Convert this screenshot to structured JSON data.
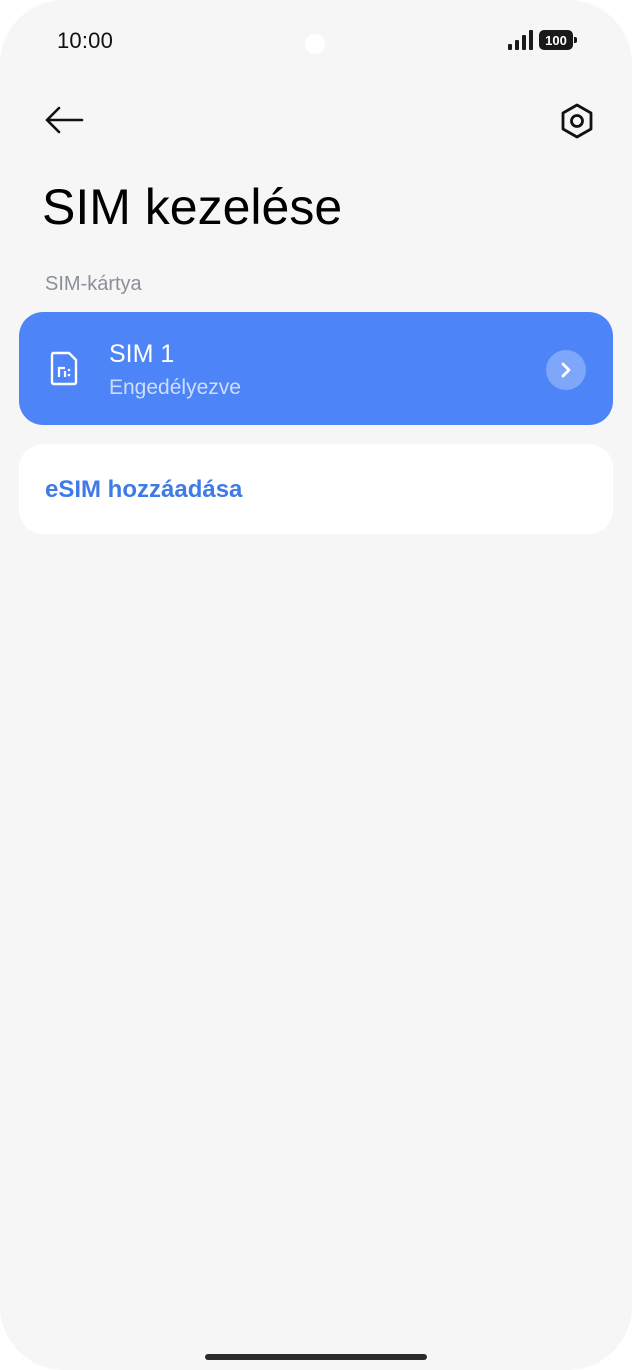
{
  "status_bar": {
    "time": "10:00",
    "battery": "100",
    "signal_icon": "signal-bars-icon"
  },
  "header": {
    "back_icon": "arrow-left-icon",
    "settings_icon": "gear-hexagon-icon",
    "title": "SIM kezelése"
  },
  "section": {
    "label": "SIM-kártya"
  },
  "sim_item": {
    "icon": "sim-card-icon",
    "title": "SIM 1",
    "subtitle": "Engedélyezve",
    "chevron_icon": "chevron-right-icon",
    "color": "#4d84f7"
  },
  "esim_item": {
    "label": "eSIM hozzáadása",
    "color": "#3f7ae6"
  },
  "colors": {
    "background": "#f6f6f6",
    "card": "#ffffff",
    "accent": "#4d84f7"
  }
}
